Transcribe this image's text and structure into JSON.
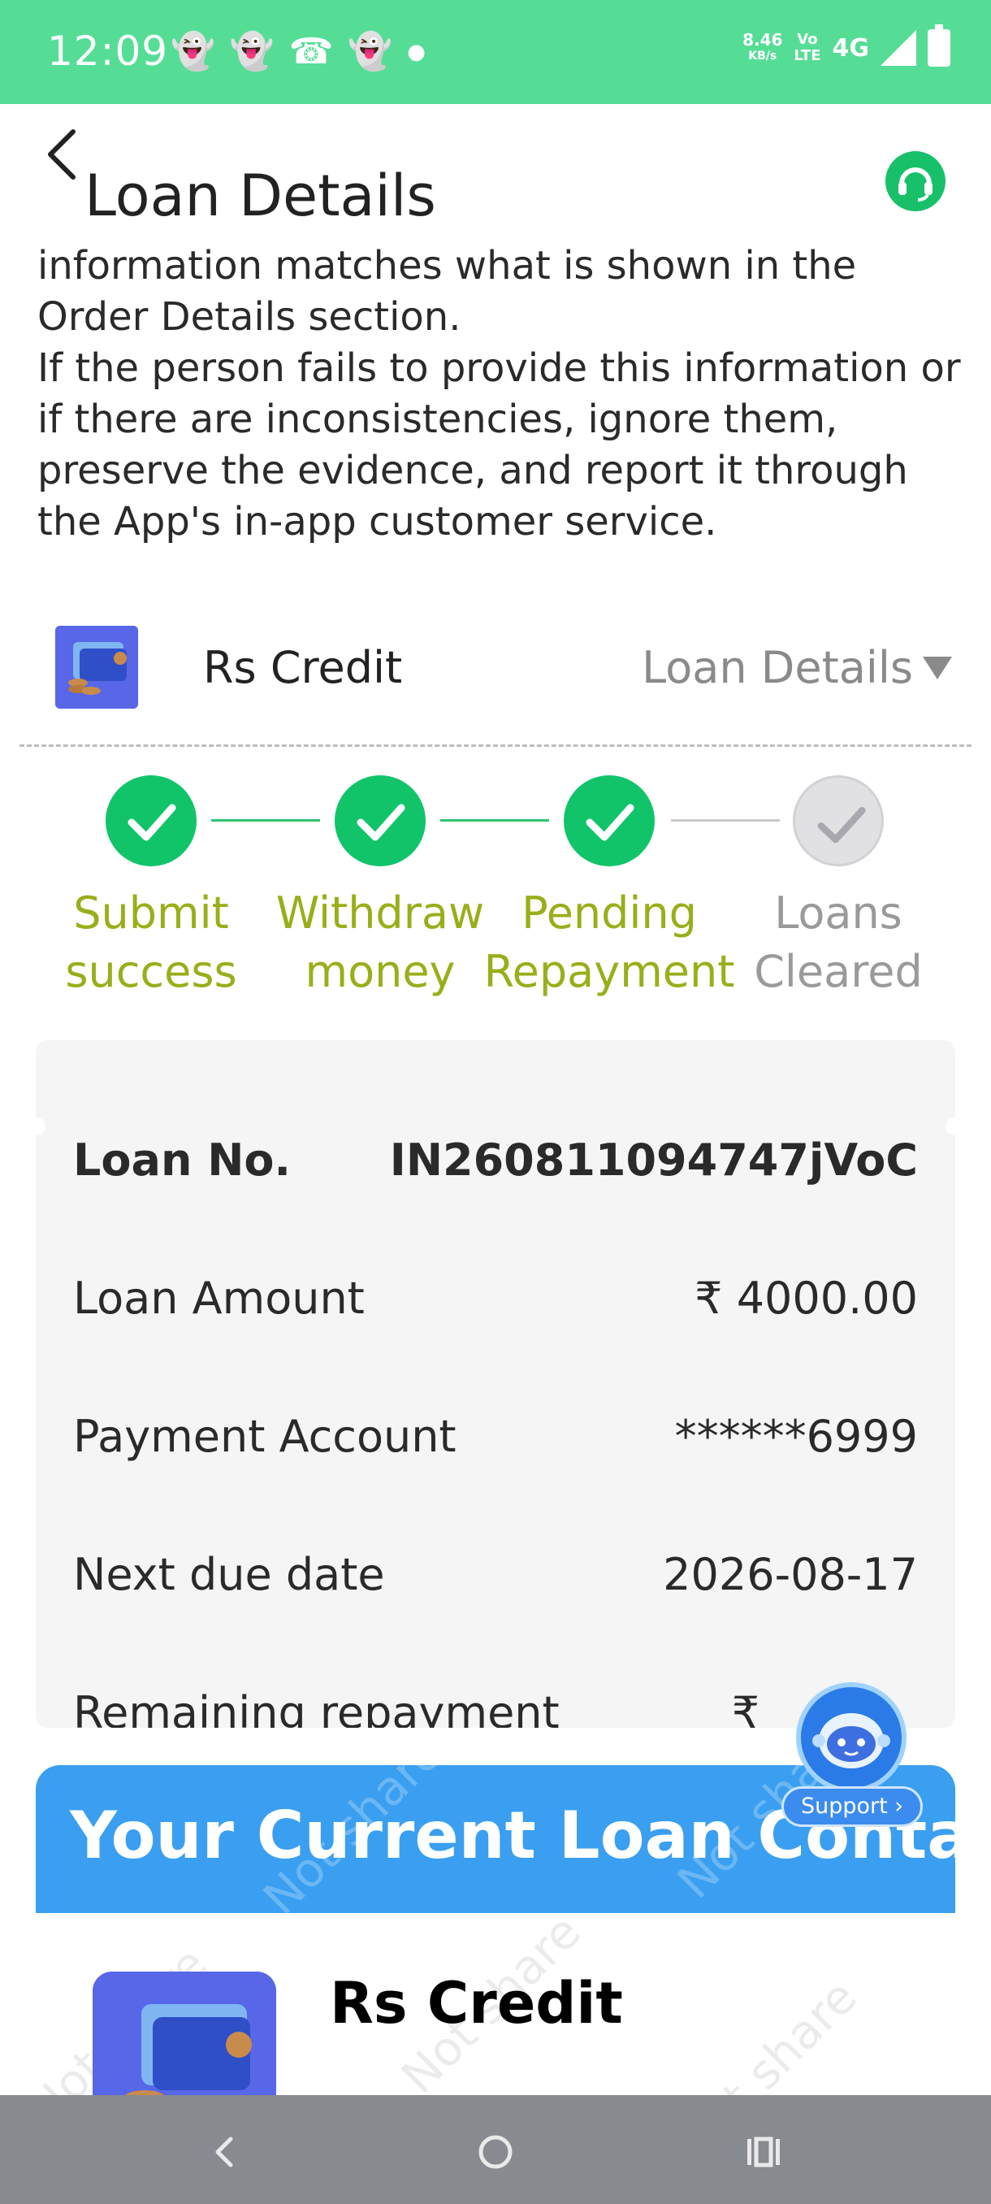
{
  "status_bar": {
    "time": "12:09",
    "net_speed_value": "8.46",
    "net_speed_unit": "KB/s",
    "volte_top": "Vo",
    "volte_bottom": "LTE",
    "network": "4G",
    "notification_icons": [
      "snapchat-icon",
      "snapchat-icon",
      "whatsapp-icon",
      "snapchat-icon"
    ]
  },
  "header": {
    "title": "Loan Details"
  },
  "instructions": {
    "lines": [
      "information matches what is shown in the Order Details section.",
      "If the person fails to provide this information or if there are inconsistencies, ignore them, preserve the evidence, and report it through the App's in-app customer service."
    ]
  },
  "app_row": {
    "app_name": "Rs Credit",
    "link_label": "Loan Details"
  },
  "stepper": {
    "steps": [
      {
        "line1": "Submit",
        "line2": "success",
        "completed": true
      },
      {
        "line1": "Withdraw",
        "line2": "money",
        "completed": true
      },
      {
        "line1": "Pending",
        "line2": "Repayment",
        "completed": true
      },
      {
        "line1": "Loans",
        "line2": "Cleared",
        "completed": false
      }
    ]
  },
  "loan": {
    "rows": [
      {
        "label": "Loan No.",
        "value": "IN260811094747jVoC"
      },
      {
        "label": "Loan Amount",
        "value": "₹ 4000.00"
      },
      {
        "label": "Payment Account",
        "value": "******6999"
      },
      {
        "label": "Next due date",
        "value": "2026-08-17"
      },
      {
        "label": "Remaining repayment",
        "value": "₹"
      }
    ]
  },
  "support": {
    "label": "Support ›"
  },
  "contact": {
    "title": "Your Current Loan Contact",
    "app_name": "Rs Credit",
    "watermark": "Not share"
  },
  "colors": {
    "status_bar": "#55dd96",
    "step_complete": "#11c46a",
    "step_label": "#9aae1a",
    "contact_header": "#3a9ff0",
    "nav_bar": "#878a8f"
  }
}
